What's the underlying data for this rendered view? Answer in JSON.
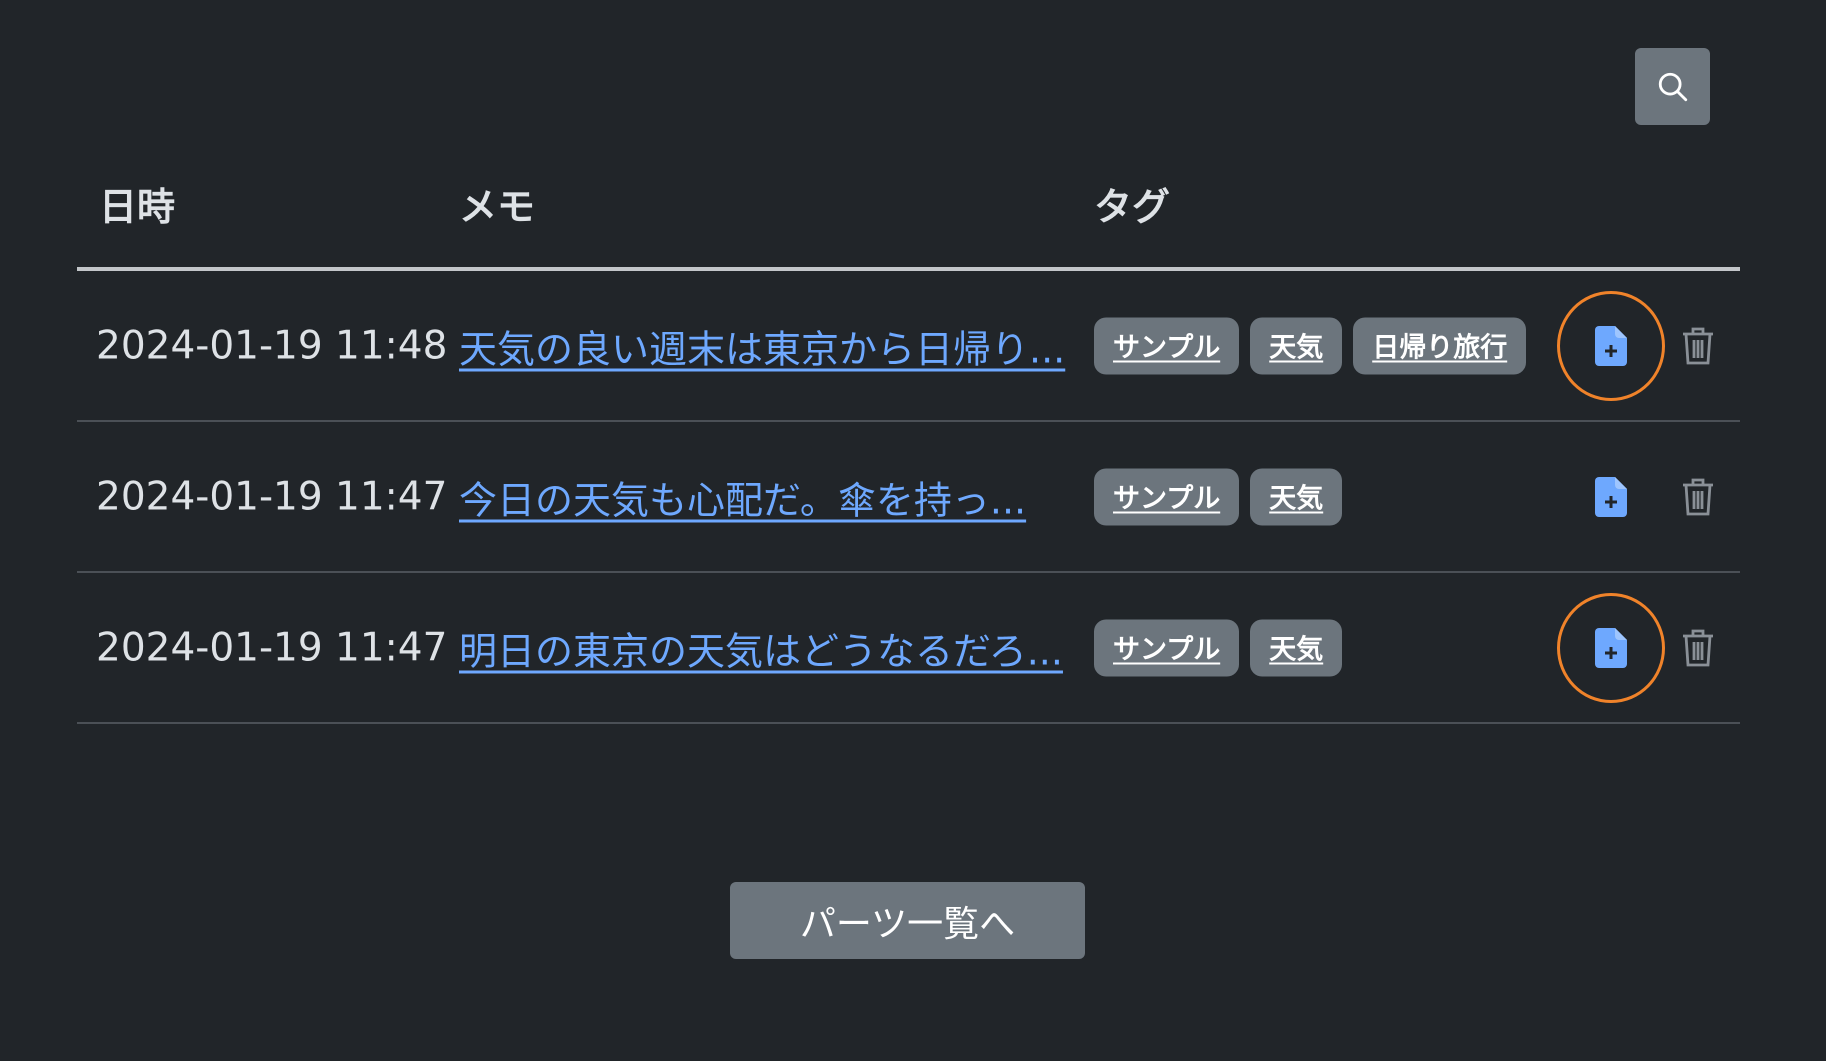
{
  "header": {
    "search_icon": "search-icon"
  },
  "table": {
    "columns": [
      "日時",
      "メモ",
      "タグ"
    ],
    "rows": [
      {
        "date": "2024-01-19 11:48",
        "memo": "天気の良い週末は東京から日帰り...",
        "tags": [
          "サンプル",
          "天気",
          "日帰り旅行"
        ],
        "highlighted": true
      },
      {
        "date": "2024-01-19 11:47",
        "memo": "今日の天気も心配だ。傘を持っ...",
        "tags": [
          "サンプル",
          "天気"
        ],
        "highlighted": false
      },
      {
        "date": "2024-01-19 11:47",
        "memo": "明日の東京の天気はどうなるだろ...",
        "tags": [
          "サンプル",
          "天気"
        ],
        "highlighted": true
      }
    ]
  },
  "footer": {
    "parts_button_label": "パーツ一覧へ"
  },
  "colors": {
    "background": "#212529",
    "link": "#6ea8fe",
    "tag_bg": "#6c757d",
    "add_icon": "#6ea8fe",
    "highlight_ring": "#f0832a"
  }
}
